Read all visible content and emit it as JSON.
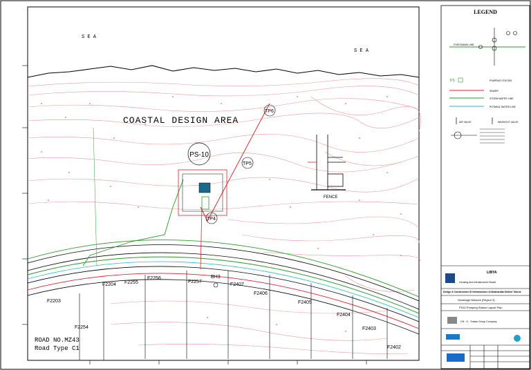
{
  "drawing": {
    "sea_label_left": "S E A",
    "sea_label_right": "S E A",
    "area_label": "COASTAL DESIGN AREA",
    "station_label": "PS-10",
    "fence_label": "FENCE",
    "bh_label": "BH3",
    "road_label_1": "ROAD NO.MZ43",
    "road_label_2": "Road Type C1",
    "tp_labels": [
      "TP6",
      "TP5",
      "TP4"
    ],
    "plot_labels": [
      "F2203",
      "F2254",
      "F2255",
      "F2256",
      "F2257",
      "F2407",
      "F2406",
      "F2405",
      "F2404",
      "F2403",
      "F2402",
      "F2204"
    ]
  },
  "legend": {
    "title": "LEGEND",
    "entries": [
      "FORCEMAIN LINE",
      "PUMPING STATION",
      "SEWER",
      "STORM WATER LINE",
      "POTABLE WATER LINE",
      "AIR VALVE",
      "WASHOUT VALVE"
    ],
    "ps_symbol": "PS"
  },
  "title_block": {
    "country": "LIBYA",
    "org": "Housing And Infrastructure Board",
    "project": "Design & Construction Of Infrastructure Al-Mukharaba District Tobruk",
    "drawing_title": "Sewerage Network (Region 3)",
    "sheet_title": "PS10 Pumping Station Layout Plan",
    "consultant": "CN - G - Suisse Group Company"
  },
  "colors": {
    "sewer": "#e0202a",
    "storm": "#2a9a2a",
    "potable": "#20b8c8",
    "contour": "#e89a9a",
    "forcemain": "#d03030"
  }
}
